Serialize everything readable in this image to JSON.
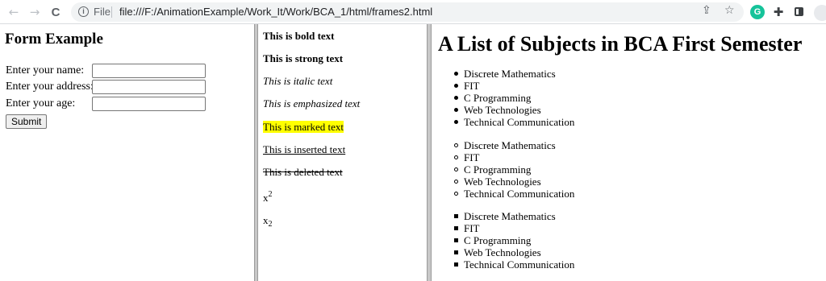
{
  "browser": {
    "back_icon": "←",
    "forward_icon": "→",
    "reload_icon": "C",
    "info_icon": "i",
    "file_label": "File",
    "url": "file:///F:/AnimationExample/Work_It/Work/BCA_1/html/frames2.html",
    "share_icon": "⇪",
    "bookmark_icon": "☆",
    "grammarly_label": "G",
    "extensions_icon": "✚"
  },
  "left_frame": {
    "heading": "Form Example",
    "name_label": "Enter your name:",
    "address_label": "Enter your address:",
    "age_label": "Enter your age:",
    "name_value": "",
    "address_value": "",
    "age_value": "",
    "submit_label": "Submit"
  },
  "middle_frame": {
    "bold": "This is bold text",
    "strong": "This is strong text",
    "italic": "This is italic text",
    "emphasized": "This is emphasized text",
    "marked": "This is marked text",
    "inserted": "This is inserted text",
    "deleted": "This is deleted text",
    "sup_base": "x",
    "sup_exp": "2",
    "sub_base": "x",
    "sub_idx": "2"
  },
  "right_frame": {
    "heading": "A List of Subjects in BCA First Semester",
    "list_disc": [
      "Discrete Mathematics",
      "FIT",
      "C Programming",
      "Web Technologies",
      "Technical Communication"
    ],
    "list_circle": [
      "Discrete Mathematics",
      "FIT",
      "C Programming",
      "Web Technologies",
      "Technical Communication"
    ],
    "list_square": [
      "Discrete Mathematics",
      "FIT",
      "C Programming",
      "Web Technologies",
      "Technical Communication"
    ]
  }
}
